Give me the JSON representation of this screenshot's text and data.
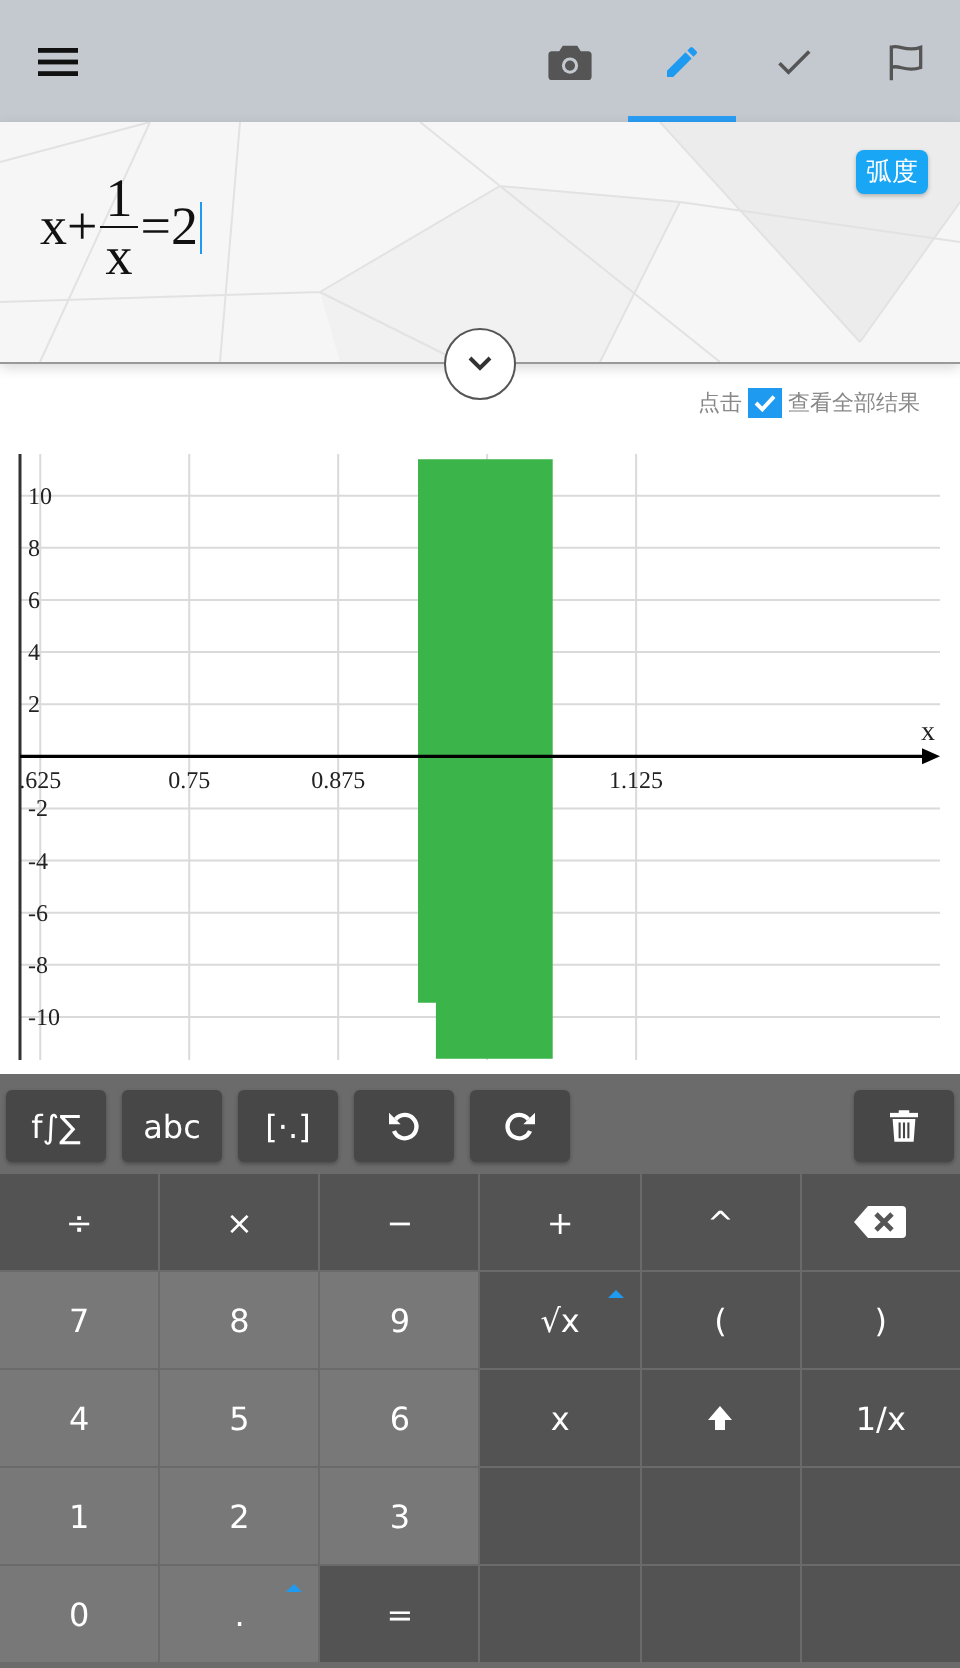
{
  "top_bar": {
    "tabs": [
      {
        "selected": false
      },
      {
        "selected": true
      },
      {
        "selected": false
      },
      {
        "selected": false
      }
    ]
  },
  "input": {
    "formula": {
      "lhs": "x+",
      "numerator": "1",
      "denominator": "x",
      "rhs": "=2"
    },
    "angle_mode": "弧度"
  },
  "show_all": {
    "before": "点击",
    "checked": true,
    "after": "查看全部结果"
  },
  "graph": {
    "axis_label": "x",
    "chart_data": {
      "type": "area",
      "grid": true,
      "xlim": [
        0.608,
        1.38
      ],
      "ylim": [
        -11.65,
        11.6
      ],
      "xticks": [
        {
          "value": 0.625,
          "label": ".625"
        },
        {
          "value": 0.75,
          "label": "0.75"
        },
        {
          "value": 0.875,
          "label": "0.875"
        },
        {
          "value": 1.125,
          "label": "1.125"
        }
      ],
      "yticks": [
        10,
        8,
        6,
        4,
        2,
        -2,
        -4,
        -6,
        -8,
        -10
      ],
      "x": [
        0.942,
        0.942,
        0.957,
        0.957,
        1.055,
        1.055
      ],
      "series": [
        {
          "color": "#3bb44a",
          "values": [
            11.4,
            -9.45,
            -9.45,
            -11.6,
            -11.6,
            11.4
          ]
        }
      ]
    }
  },
  "toolbar": [
    {
      "kind": "text",
      "label": "f∫∑"
    },
    {
      "kind": "text",
      "label": "abc"
    },
    {
      "kind": "text",
      "label": "[·.]"
    },
    {
      "kind": "icon"
    },
    {
      "kind": "icon"
    }
  ],
  "keys": [
    [
      {
        "kind": "operator",
        "label": "÷"
      },
      {
        "kind": "operator",
        "label": "×"
      },
      {
        "kind": "operator",
        "label": "−"
      },
      {
        "kind": "operator",
        "label": "+"
      },
      {
        "kind": "operator",
        "label": "^"
      },
      {
        "kind": "icon"
      }
    ],
    [
      {
        "kind": "digit",
        "label": "7"
      },
      {
        "kind": "digit",
        "label": "8"
      },
      {
        "kind": "digit",
        "label": "9"
      },
      {
        "kind": "operator",
        "label": "√x",
        "more": true
      },
      {
        "kind": "operator",
        "label": "("
      },
      {
        "kind": "operator",
        "label": ")"
      }
    ],
    [
      {
        "kind": "digit",
        "label": "4"
      },
      {
        "kind": "digit",
        "label": "5"
      },
      {
        "kind": "digit",
        "label": "6"
      },
      {
        "kind": "operator",
        "label": "x"
      },
      {
        "kind": "icon"
      },
      {
        "kind": "operator",
        "label": "1/x"
      }
    ],
    [
      {
        "kind": "digit",
        "label": "1"
      },
      {
        "kind": "digit",
        "label": "2"
      },
      {
        "kind": "digit",
        "label": "3"
      },
      {
        "kind": "blank"
      },
      {
        "kind": "blank"
      },
      {
        "kind": "blank"
      }
    ],
    [
      {
        "kind": "digit",
        "label": "0"
      },
      {
        "kind": "digit",
        "label": ".",
        "more": true
      },
      {
        "kind": "operator",
        "label": "="
      },
      {
        "kind": "blank"
      },
      {
        "kind": "blank"
      },
      {
        "kind": "blank"
      }
    ]
  ]
}
